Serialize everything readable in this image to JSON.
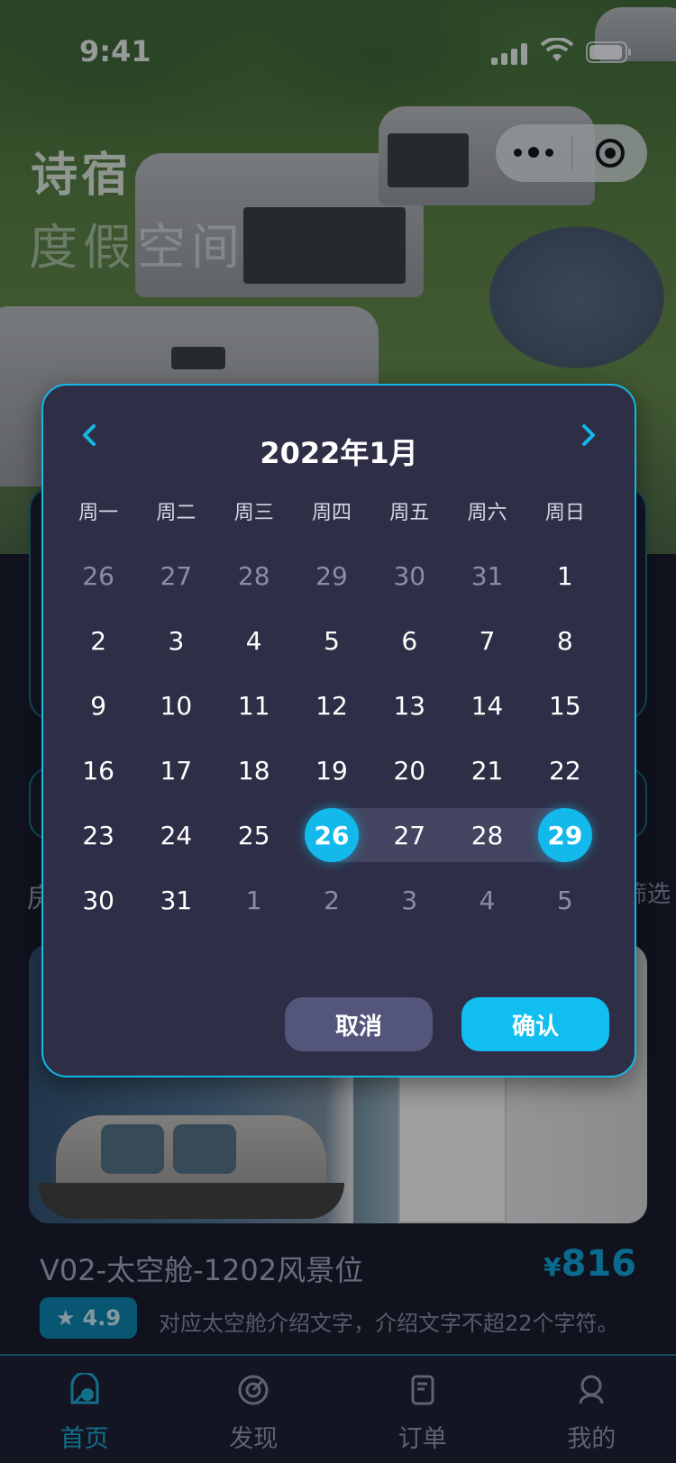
{
  "status_bar": {
    "time": "9:41"
  },
  "hero": {
    "title": "诗宿",
    "subtitle": "度假空间"
  },
  "section": {
    "left_label": "房",
    "right_label": "筛选"
  },
  "room": {
    "title": "V02-太空舱-1202风景位",
    "price_currency": "¥",
    "price": "816",
    "rating": "4.9",
    "description": "对应太空舱介绍文字，介绍文字不超22个字符。"
  },
  "calendar": {
    "month_title": "2022年1月",
    "weekdays": [
      "周一",
      "周二",
      "周三",
      "周四",
      "周五",
      "周六",
      "周日"
    ],
    "weeks": [
      [
        "26",
        "27",
        "28",
        "29",
        "30",
        "31",
        "1"
      ],
      [
        "2",
        "3",
        "4",
        "5",
        "6",
        "7",
        "8"
      ],
      [
        "9",
        "10",
        "11",
        "12",
        "13",
        "14",
        "15"
      ],
      [
        "16",
        "17",
        "18",
        "19",
        "20",
        "21",
        "22"
      ],
      [
        "23",
        "24",
        "25",
        "26",
        "27",
        "28",
        "29"
      ],
      [
        "30",
        "31",
        "1",
        "2",
        "3",
        "4",
        "5"
      ]
    ],
    "outside_month": [
      [
        0,
        0
      ],
      [
        0,
        1
      ],
      [
        0,
        2
      ],
      [
        0,
        3
      ],
      [
        0,
        4
      ],
      [
        0,
        5
      ],
      [
        5,
        2
      ],
      [
        5,
        3
      ],
      [
        5,
        4
      ],
      [
        5,
        5
      ],
      [
        5,
        6
      ]
    ],
    "range_start": "26",
    "range_end": "29",
    "cancel_label": "取消",
    "confirm_label": "确认"
  },
  "tabbar": {
    "items": [
      {
        "label": "首页",
        "icon": "home-icon",
        "active": true
      },
      {
        "label": "发现",
        "icon": "discover-icon",
        "active": false
      },
      {
        "label": "订单",
        "icon": "order-icon",
        "active": false
      },
      {
        "label": "我的",
        "icon": "profile-icon",
        "active": false
      }
    ]
  },
  "colors": {
    "accent": "#12b9ea",
    "modal_bg": "#2e2f47",
    "page_bg": "#151824",
    "price": "#0c9ed0"
  }
}
